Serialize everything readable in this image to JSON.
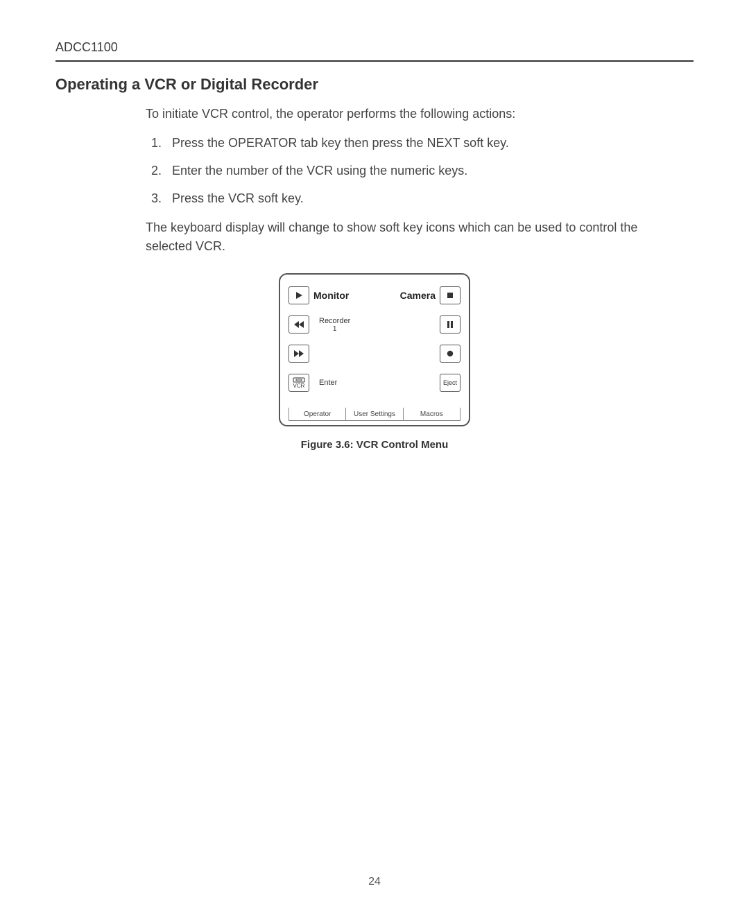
{
  "header": {
    "doc_id": "ADCC1100"
  },
  "section": {
    "title": "Operating a VCR or Digital Recorder",
    "intro": "To initiate VCR control, the operator performs the following actions:",
    "steps": [
      "Press the OPERATOR tab key then press the NEXT soft key.",
      "Enter the number of the VCR using the numeric keys.",
      "Press the VCR soft key."
    ],
    "after": "The keyboard display will change to show soft key icons which can be used to control the selected VCR."
  },
  "panel": {
    "row1": {
      "left_icon": "play",
      "center_left": "Monitor",
      "center_right": "Camera",
      "right_icon": "stop"
    },
    "row2": {
      "left_icon": "rewind",
      "center_label": "Recorder",
      "center_sub": "1",
      "right_icon": "pause"
    },
    "row3": {
      "left_icon": "fast-forward",
      "right_icon": "record"
    },
    "row4": {
      "left_icon": "vcr",
      "left_sub": "VCR",
      "center_label": "Enter",
      "right_label": "Eject"
    },
    "tabs": [
      "Operator",
      "User Settings",
      "Macros"
    ]
  },
  "figure": {
    "caption": "Figure 3.6: VCR Control Menu"
  },
  "page_number": "24"
}
